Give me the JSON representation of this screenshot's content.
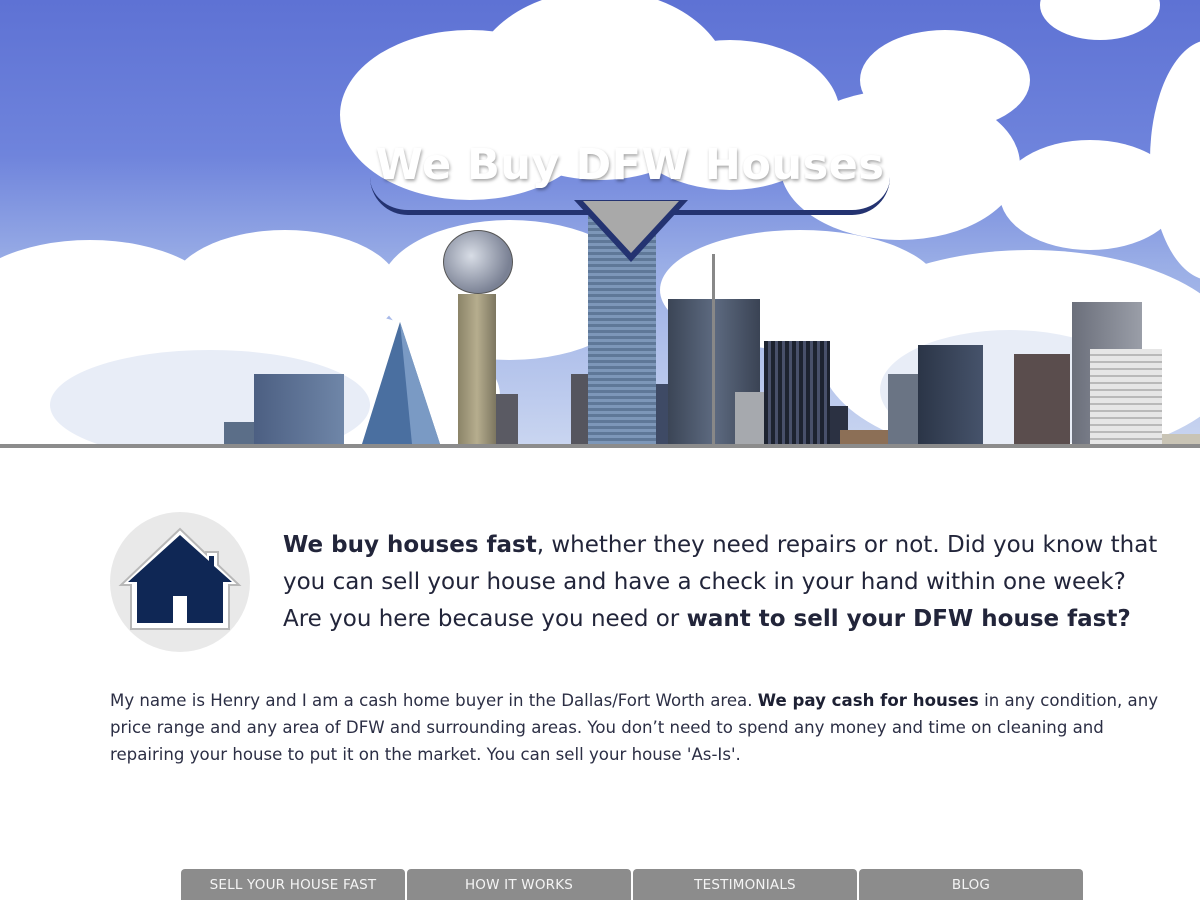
{
  "hero": {
    "title": "We Buy DFW Houses"
  },
  "intro": {
    "lead_bold_1": "We buy houses fast",
    "lead_text_1": ", whether they need repairs or not. Did you know that you can sell your house and have a check in your hand within one week? Are you here because you need or ",
    "lead_bold_2": "want to sell your DFW house fast?",
    "body_text_1": "My name is Henry and I am a cash home buyer in the Dallas/Fort Worth area. ",
    "body_bold": "We pay cash for houses",
    "body_text_2": " in any condition, any price range and any area of DFW and surrounding areas. You don’t need to spend any money and time on cleaning and repairing your house to put it on the market. You can sell your house 'As-Is'."
  },
  "nav": {
    "items": [
      {
        "label": "SELL YOUR HOUSE FAST"
      },
      {
        "label": "HOW IT WORKS"
      },
      {
        "label": "TESTIMONIALS"
      },
      {
        "label": "BLOG"
      }
    ]
  },
  "colors": {
    "banner_navy": "#243371",
    "nav_gray": "#8c8c8c",
    "house_navy": "#0f2755",
    "text": "#22253a"
  },
  "icons": {
    "house": "house-icon"
  }
}
